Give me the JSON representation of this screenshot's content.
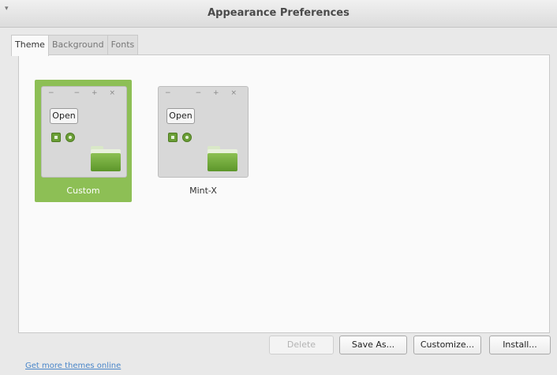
{
  "window": {
    "title": "Appearance Preferences",
    "menu_glyph": "▾"
  },
  "tabs": [
    {
      "label": "Theme",
      "active": true
    },
    {
      "label": "Background",
      "active": false
    },
    {
      "label": "Fonts",
      "active": false
    }
  ],
  "themes": [
    {
      "name": "Custom",
      "selected": true,
      "preview": {
        "open_button_label": "Open",
        "controls_left": "−",
        "controls_right": "− + ×"
      }
    },
    {
      "name": "Mint-X",
      "selected": false,
      "preview": {
        "open_button_label": "Open",
        "controls_left": "−",
        "controls_right": "− + ×"
      }
    }
  ],
  "buttons": {
    "delete": {
      "label": "Delete",
      "enabled": false
    },
    "save_as": {
      "label": "Save As...",
      "enabled": true
    },
    "customize": {
      "label": "Customize...",
      "enabled": true
    },
    "install": {
      "label": "Install...",
      "enabled": true
    }
  },
  "link": {
    "label": "Get more themes online"
  },
  "colors": {
    "selection": "#8dbf55",
    "link": "#4a86c9",
    "folder": "#6aa334"
  }
}
